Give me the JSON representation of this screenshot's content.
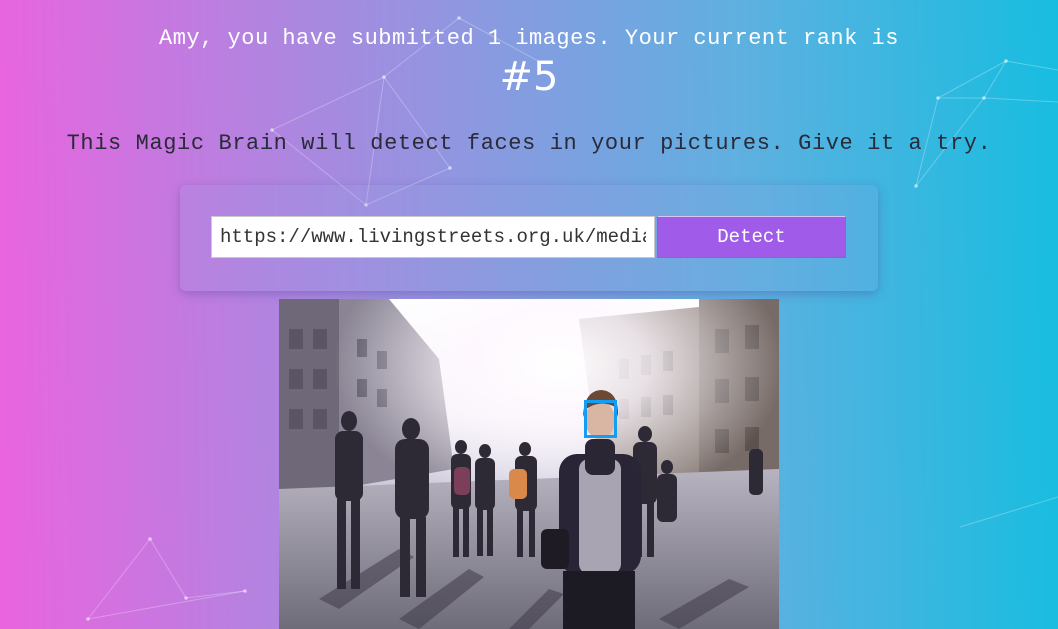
{
  "header": {
    "rank_message": "Amy, you have submitted 1 images. Your current rank is",
    "rank_value": "#5"
  },
  "intro": {
    "text": "This Magic Brain will detect faces in your pictures. Give it a try."
  },
  "form": {
    "url_value": "https://www.livingstreets.org.uk/media/street-crowd.jpg",
    "detect_label": "Detect"
  },
  "result": {
    "image_alt": "Crowd of pedestrians walking on a sunlit city street",
    "faces_detected": 1
  },
  "colors": {
    "gradient_left": "#ea64df",
    "gradient_right": "#17bde0",
    "button": "#a05ce8",
    "face_box": "#149df2"
  }
}
